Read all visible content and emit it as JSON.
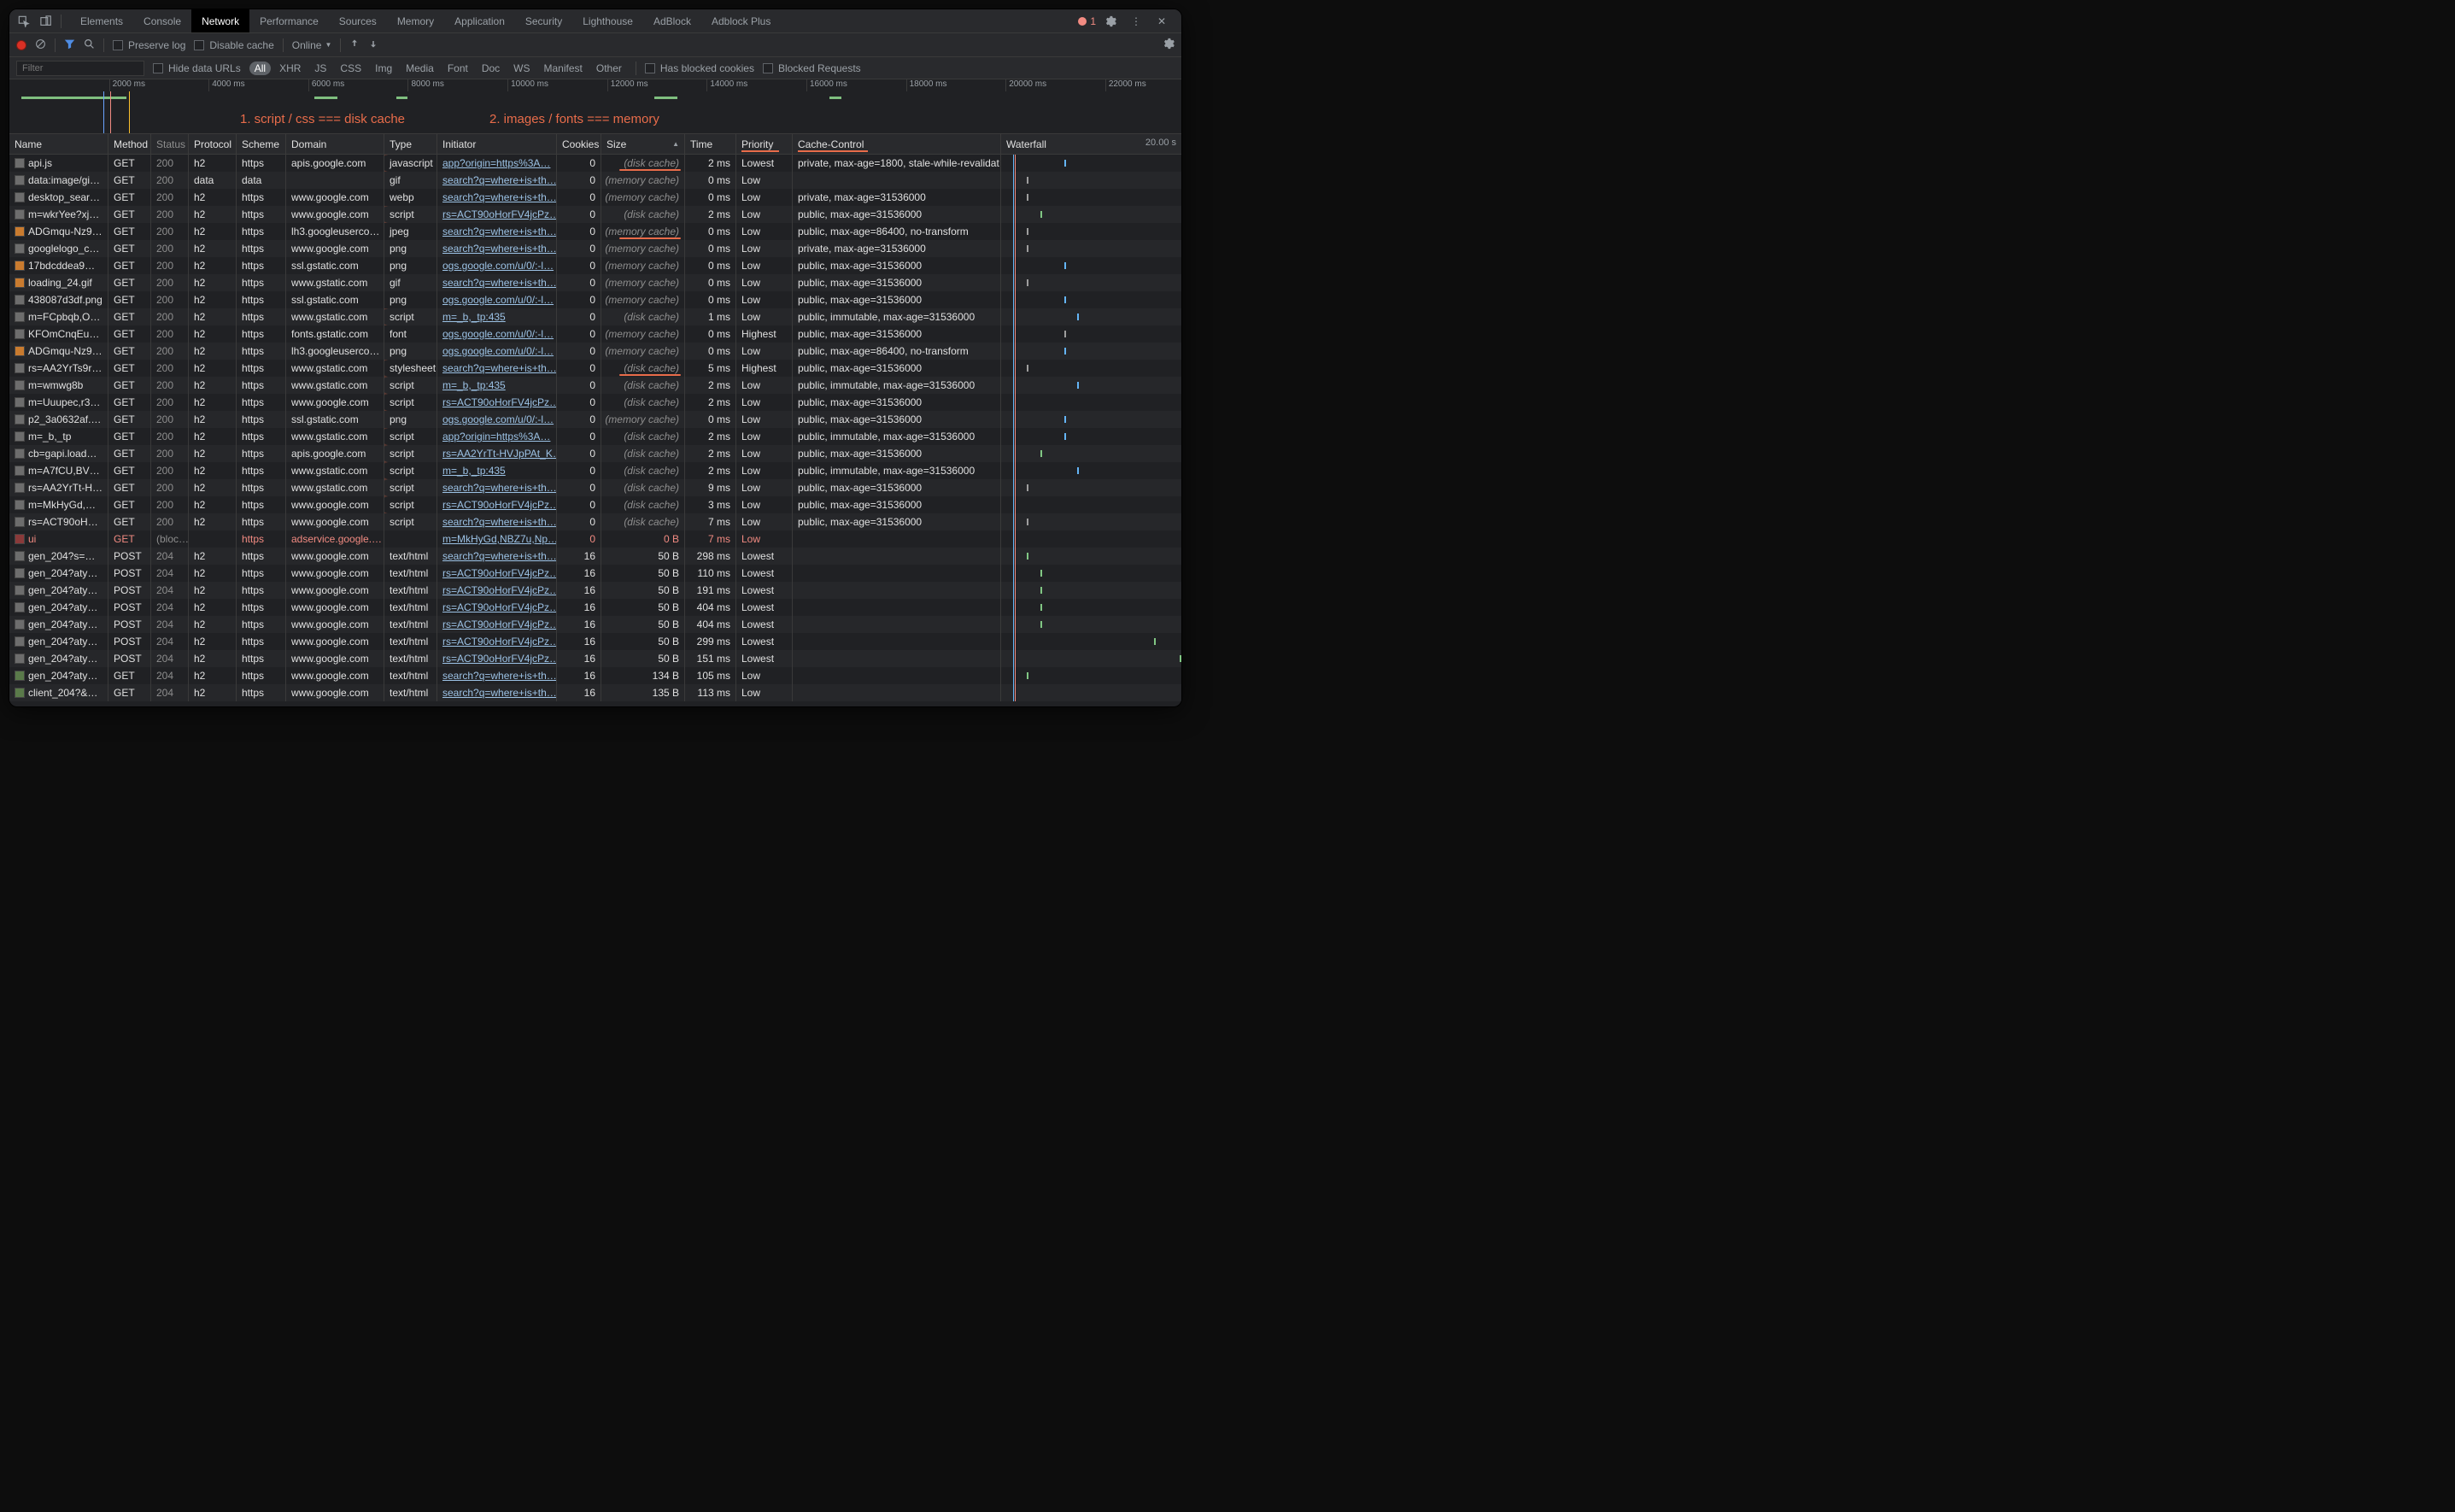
{
  "tabs": [
    "Elements",
    "Console",
    "Network",
    "Performance",
    "Sources",
    "Memory",
    "Application",
    "Security",
    "Lighthouse",
    "AdBlock",
    "Adblock Plus"
  ],
  "active_tab": "Network",
  "error_count": "1",
  "toolbar": {
    "preserve_log": "Preserve log",
    "disable_cache": "Disable cache",
    "throttle": "Online"
  },
  "filterbar": {
    "placeholder": "Filter",
    "hide_data_urls": "Hide data URLs",
    "pills": [
      "All",
      "XHR",
      "JS",
      "CSS",
      "Img",
      "Media",
      "Font",
      "Doc",
      "WS",
      "Manifest",
      "Other"
    ],
    "has_blocked_cookies": "Has blocked cookies",
    "blocked_requests": "Blocked Requests"
  },
  "timeline_ticks": [
    "2000 ms",
    "4000 ms",
    "6000 ms",
    "8000 ms",
    "10000 ms",
    "12000 ms",
    "14000 ms",
    "16000 ms",
    "18000 ms",
    "20000 ms",
    "22000 ms"
  ],
  "annotations": {
    "a1": "1.  script / css === disk cache",
    "a2": "2. images / fonts === memory"
  },
  "columns": [
    "Name",
    "Method",
    "Status",
    "Protocol",
    "Scheme",
    "Domain",
    "Type",
    "Initiator",
    "Cookies",
    "Size",
    "Time",
    "Priority",
    "Cache-Control",
    "Waterfall"
  ],
  "waterfall_end": "20.00 s",
  "rows": [
    {
      "name": "api.js",
      "method": "GET",
      "status": "200",
      "proto": "h2",
      "scheme": "https",
      "domain": "apis.google.com",
      "type": "javascript",
      "initiator": "app?origin=https%3A…",
      "cookies": "0",
      "size": "(disk cache)",
      "size_muted": true,
      "time": "2 ms",
      "priority": "Lowest",
      "cache": "private, max-age=1800, stale-while-revalidat…",
      "arc": true,
      "size_under": true,
      "wf": [
        {
          "p": 35,
          "c": "blue"
        }
      ]
    },
    {
      "name": "data:image/gif;…",
      "method": "GET",
      "status": "200",
      "proto": "data",
      "scheme": "data",
      "domain": "",
      "type": "gif",
      "initiator": "search?q=where+is+th…",
      "cookies": "0",
      "size": "(memory cache)",
      "size_muted": true,
      "time": "0 ms",
      "priority": "Low",
      "cache": "",
      "wf": [
        {
          "p": 14,
          "c": "grey"
        }
      ]
    },
    {
      "name": "desktop_sear…",
      "method": "GET",
      "status": "200",
      "proto": "h2",
      "scheme": "https",
      "domain": "www.google.com",
      "type": "webp",
      "initiator": "search?q=where+is+th…",
      "cookies": "0",
      "size": "(memory cache)",
      "size_muted": true,
      "time": "0 ms",
      "priority": "Low",
      "cache": "private, max-age=31536000",
      "wf": [
        {
          "p": 14,
          "c": "grey"
        }
      ]
    },
    {
      "name": "m=wkrYee?xjs…",
      "method": "GET",
      "status": "200",
      "proto": "h2",
      "scheme": "https",
      "domain": "www.google.com",
      "type": "script",
      "initiator": "rs=ACT90oHorFV4jcPz…",
      "cookies": "0",
      "size": "(disk cache)",
      "size_muted": true,
      "time": "2 ms",
      "priority": "Low",
      "cache": "public, max-age=31536000",
      "arc": true,
      "wf": [
        {
          "p": 22,
          "c": "green"
        }
      ]
    },
    {
      "name": "ADGmqu-Nz9…",
      "method": "GET",
      "status": "200",
      "proto": "h2",
      "scheme": "https",
      "domain": "lh3.googleuserco…",
      "type": "jpeg",
      "initiator": "search?q=where+is+th…",
      "cookies": "0",
      "size": "(memory cache)",
      "size_muted": true,
      "time": "0 ms",
      "priority": "Low",
      "cache": "public, max-age=86400, no-transform",
      "ico": "orange",
      "size_under": true,
      "wf": [
        {
          "p": 14,
          "c": "grey"
        }
      ]
    },
    {
      "name": "googlelogo_c…",
      "method": "GET",
      "status": "200",
      "proto": "h2",
      "scheme": "https",
      "domain": "www.google.com",
      "type": "png",
      "initiator": "search?q=where+is+th…",
      "cookies": "0",
      "size": "(memory cache)",
      "size_muted": true,
      "time": "0 ms",
      "priority": "Low",
      "cache": "private, max-age=31536000",
      "wf": [
        {
          "p": 14,
          "c": "grey"
        }
      ]
    },
    {
      "name": "17bdcddea9…",
      "method": "GET",
      "status": "200",
      "proto": "h2",
      "scheme": "https",
      "domain": "ssl.gstatic.com",
      "type": "png",
      "initiator": "ogs.google.com/u/0/:-l…",
      "cookies": "0",
      "size": "(memory cache)",
      "size_muted": true,
      "time": "0 ms",
      "priority": "Low",
      "cache": "public, max-age=31536000",
      "ico": "orange",
      "wf": [
        {
          "p": 35,
          "c": "blue"
        }
      ]
    },
    {
      "name": "loading_24.gif",
      "method": "GET",
      "status": "200",
      "proto": "h2",
      "scheme": "https",
      "domain": "www.gstatic.com",
      "type": "gif",
      "initiator": "search?q=where+is+th…",
      "cookies": "0",
      "size": "(memory cache)",
      "size_muted": true,
      "time": "0 ms",
      "priority": "Low",
      "cache": "public, max-age=31536000",
      "ico": "orange",
      "wf": [
        {
          "p": 14,
          "c": "grey"
        }
      ]
    },
    {
      "name": "438087d3df.png",
      "method": "GET",
      "status": "200",
      "proto": "h2",
      "scheme": "https",
      "domain": "ssl.gstatic.com",
      "type": "png",
      "initiator": "ogs.google.com/u/0/:-l…",
      "cookies": "0",
      "size": "(memory cache)",
      "size_muted": true,
      "time": "0 ms",
      "priority": "Low",
      "cache": "public, max-age=31536000",
      "wf": [
        {
          "p": 35,
          "c": "blue"
        }
      ]
    },
    {
      "name": "m=FCpbqb,O…",
      "method": "GET",
      "status": "200",
      "proto": "h2",
      "scheme": "https",
      "domain": "www.gstatic.com",
      "type": "script",
      "initiator": "m=_b,_tp:435",
      "cookies": "0",
      "size": "(disk cache)",
      "size_muted": true,
      "time": "1 ms",
      "priority": "Low",
      "cache": "public, immutable, max-age=31536000",
      "arc": true,
      "wf": [
        {
          "p": 42,
          "c": "blue"
        }
      ]
    },
    {
      "name": "KFOmCnqEu9…",
      "method": "GET",
      "status": "200",
      "proto": "h2",
      "scheme": "https",
      "domain": "fonts.gstatic.com",
      "type": "font",
      "initiator": "ogs.google.com/u/0/:-l…",
      "cookies": "0",
      "size": "(memory cache)",
      "size_muted": true,
      "time": "0 ms",
      "priority": "Highest",
      "cache": "public, max-age=31536000",
      "wf": [
        {
          "p": 35,
          "c": "grey"
        }
      ]
    },
    {
      "name": "ADGmqu-Nz9…",
      "method": "GET",
      "status": "200",
      "proto": "h2",
      "scheme": "https",
      "domain": "lh3.googleuserco…",
      "type": "png",
      "initiator": "ogs.google.com/u/0/:-l…",
      "cookies": "0",
      "size": "(memory cache)",
      "size_muted": true,
      "time": "0 ms",
      "priority": "Low",
      "cache": "public, max-age=86400, no-transform",
      "ico": "orange",
      "wf": [
        {
          "p": 35,
          "c": "blue"
        }
      ]
    },
    {
      "name": "rs=AA2YrTs9r…",
      "method": "GET",
      "status": "200",
      "proto": "h2",
      "scheme": "https",
      "domain": "www.gstatic.com",
      "type": "stylesheet",
      "initiator": "search?q=where+is+th…",
      "cookies": "0",
      "size": "(disk cache)",
      "size_muted": true,
      "time": "5 ms",
      "priority": "Highest",
      "cache": "public, max-age=31536000",
      "arc": true,
      "size_under": true,
      "wf": [
        {
          "p": 14,
          "c": "grey"
        }
      ]
    },
    {
      "name": "m=wmwg8b",
      "method": "GET",
      "status": "200",
      "proto": "h2",
      "scheme": "https",
      "domain": "www.gstatic.com",
      "type": "script",
      "initiator": "m=_b,_tp:435",
      "cookies": "0",
      "size": "(disk cache)",
      "size_muted": true,
      "time": "2 ms",
      "priority": "Low",
      "cache": "public, immutable, max-age=31536000",
      "arc": true,
      "wf": [
        {
          "p": 42,
          "c": "blue"
        }
      ]
    },
    {
      "name": "m=Uuupec,r3…",
      "method": "GET",
      "status": "200",
      "proto": "h2",
      "scheme": "https",
      "domain": "www.google.com",
      "type": "script",
      "initiator": "rs=ACT90oHorFV4jcPz…",
      "cookies": "0",
      "size": "(disk cache)",
      "size_muted": true,
      "time": "2 ms",
      "priority": "Low",
      "cache": "public, max-age=31536000",
      "arc": true,
      "wf": []
    },
    {
      "name": "p2_3a0632af.…",
      "method": "GET",
      "status": "200",
      "proto": "h2",
      "scheme": "https",
      "domain": "ssl.gstatic.com",
      "type": "png",
      "initiator": "ogs.google.com/u/0/:-l…",
      "cookies": "0",
      "size": "(memory cache)",
      "size_muted": true,
      "time": "0 ms",
      "priority": "Low",
      "cache": "public, max-age=31536000",
      "wf": [
        {
          "p": 35,
          "c": "blue"
        }
      ]
    },
    {
      "name": "m=_b,_tp",
      "method": "GET",
      "status": "200",
      "proto": "h2",
      "scheme": "https",
      "domain": "www.gstatic.com",
      "type": "script",
      "initiator": "app?origin=https%3A…",
      "cookies": "0",
      "size": "(disk cache)",
      "size_muted": true,
      "time": "2 ms",
      "priority": "Low",
      "cache": "public, immutable, max-age=31536000",
      "arc": true,
      "wf": [
        {
          "p": 35,
          "c": "blue"
        }
      ]
    },
    {
      "name": "cb=gapi.loade…",
      "method": "GET",
      "status": "200",
      "proto": "h2",
      "scheme": "https",
      "domain": "apis.google.com",
      "type": "script",
      "initiator": "rs=AA2YrTt-HVJpPAt_K…",
      "cookies": "0",
      "size": "(disk cache)",
      "size_muted": true,
      "time": "2 ms",
      "priority": "Low",
      "cache": "public, max-age=31536000",
      "arc": true,
      "wf": [
        {
          "p": 22,
          "c": "green"
        }
      ]
    },
    {
      "name": "m=A7fCU,BV…",
      "method": "GET",
      "status": "200",
      "proto": "h2",
      "scheme": "https",
      "domain": "www.gstatic.com",
      "type": "script",
      "initiator": "m=_b,_tp:435",
      "cookies": "0",
      "size": "(disk cache)",
      "size_muted": true,
      "time": "2 ms",
      "priority": "Low",
      "cache": "public, immutable, max-age=31536000",
      "arc": true,
      "wf": [
        {
          "p": 42,
          "c": "blue"
        }
      ]
    },
    {
      "name": "rs=AA2YrTt-H…",
      "method": "GET",
      "status": "200",
      "proto": "h2",
      "scheme": "https",
      "domain": "www.gstatic.com",
      "type": "script",
      "initiator": "search?q=where+is+th…",
      "cookies": "0",
      "size": "(disk cache)",
      "size_muted": true,
      "time": "9 ms",
      "priority": "Low",
      "cache": "public, max-age=31536000",
      "arc": true,
      "wf": [
        {
          "p": 14,
          "c": "grey"
        }
      ]
    },
    {
      "name": "m=MkHyGd,N…",
      "method": "GET",
      "status": "200",
      "proto": "h2",
      "scheme": "https",
      "domain": "www.google.com",
      "type": "script",
      "initiator": "rs=ACT90oHorFV4jcPz…",
      "cookies": "0",
      "size": "(disk cache)",
      "size_muted": true,
      "time": "3 ms",
      "priority": "Low",
      "cache": "public, max-age=31536000",
      "arc": true,
      "wf": []
    },
    {
      "name": "rs=ACT90oHo…",
      "method": "GET",
      "status": "200",
      "proto": "h2",
      "scheme": "https",
      "domain": "www.google.com",
      "type": "script",
      "initiator": "search?q=where+is+th…",
      "cookies": "0",
      "size": "(disk cache)",
      "size_muted": true,
      "time": "7 ms",
      "priority": "Low",
      "cache": "public, max-age=31536000",
      "wf": [
        {
          "p": 14,
          "c": "grey"
        }
      ]
    },
    {
      "name": "ui",
      "method": "GET",
      "status": "(bloc…",
      "proto": "",
      "scheme": "https",
      "domain": "adservice.google.…",
      "type": "",
      "initiator": "m=MkHyGd,NBZ7u,Np…",
      "cookies": "0",
      "size": "0 B",
      "time": "7 ms",
      "priority": "Low",
      "cache": "",
      "blocked": true,
      "ico": "blk",
      "wf": []
    },
    {
      "name": "gen_204?s=w…",
      "method": "POST",
      "status": "204",
      "proto": "h2",
      "scheme": "https",
      "domain": "www.google.com",
      "type": "text/html",
      "initiator": "search?q=where+is+th…",
      "cookies": "16",
      "size": "50 B",
      "time": "298 ms",
      "priority": "Lowest",
      "cache": "",
      "wf": [
        {
          "p": 14,
          "c": "green"
        }
      ]
    },
    {
      "name": "gen_204?atyp…",
      "method": "POST",
      "status": "204",
      "proto": "h2",
      "scheme": "https",
      "domain": "www.google.com",
      "type": "text/html",
      "initiator": "rs=ACT90oHorFV4jcPz…",
      "cookies": "16",
      "size": "50 B",
      "time": "110 ms",
      "priority": "Lowest",
      "cache": "",
      "wf": [
        {
          "p": 22,
          "c": "green"
        }
      ]
    },
    {
      "name": "gen_204?atyp…",
      "method": "POST",
      "status": "204",
      "proto": "h2",
      "scheme": "https",
      "domain": "www.google.com",
      "type": "text/html",
      "initiator": "rs=ACT90oHorFV4jcPz…",
      "cookies": "16",
      "size": "50 B",
      "time": "191 ms",
      "priority": "Lowest",
      "cache": "",
      "wf": [
        {
          "p": 22,
          "c": "green"
        }
      ]
    },
    {
      "name": "gen_204?atyp…",
      "method": "POST",
      "status": "204",
      "proto": "h2",
      "scheme": "https",
      "domain": "www.google.com",
      "type": "text/html",
      "initiator": "rs=ACT90oHorFV4jcPz…",
      "cookies": "16",
      "size": "50 B",
      "time": "404 ms",
      "priority": "Lowest",
      "cache": "",
      "wf": [
        {
          "p": 22,
          "c": "green"
        }
      ]
    },
    {
      "name": "gen_204?atyp…",
      "method": "POST",
      "status": "204",
      "proto": "h2",
      "scheme": "https",
      "domain": "www.google.com",
      "type": "text/html",
      "initiator": "rs=ACT90oHorFV4jcPz…",
      "cookies": "16",
      "size": "50 B",
      "time": "404 ms",
      "priority": "Lowest",
      "cache": "",
      "wf": [
        {
          "p": 22,
          "c": "green"
        }
      ]
    },
    {
      "name": "gen_204?atyp…",
      "method": "POST",
      "status": "204",
      "proto": "h2",
      "scheme": "https",
      "domain": "www.google.com",
      "type": "text/html",
      "initiator": "rs=ACT90oHorFV4jcPz…",
      "cookies": "16",
      "size": "50 B",
      "time": "299 ms",
      "priority": "Lowest",
      "cache": "",
      "wf": [
        {
          "p": 85,
          "c": "green"
        }
      ]
    },
    {
      "name": "gen_204?atyp…",
      "method": "POST",
      "status": "204",
      "proto": "h2",
      "scheme": "https",
      "domain": "www.google.com",
      "type": "text/html",
      "initiator": "rs=ACT90oHorFV4jcPz…",
      "cookies": "16",
      "size": "50 B",
      "time": "151 ms",
      "priority": "Lowest",
      "cache": "",
      "wf": [
        {
          "p": 99,
          "c": "green"
        }
      ]
    },
    {
      "name": "gen_204?atyp…",
      "method": "GET",
      "status": "204",
      "proto": "h2",
      "scheme": "https",
      "domain": "www.google.com",
      "type": "text/html",
      "initiator": "search?q=where+is+th…",
      "cookies": "16",
      "size": "134 B",
      "time": "105 ms",
      "priority": "Low",
      "cache": "",
      "ico": "img",
      "wf": [
        {
          "p": 14,
          "c": "green"
        }
      ]
    },
    {
      "name": "client_204?&…",
      "method": "GET",
      "status": "204",
      "proto": "h2",
      "scheme": "https",
      "domain": "www.google.com",
      "type": "text/html",
      "initiator": "search?q=where+is+th…",
      "cookies": "16",
      "size": "135 B",
      "time": "113 ms",
      "priority": "Low",
      "cache": "",
      "ico": "img",
      "wf": []
    }
  ]
}
